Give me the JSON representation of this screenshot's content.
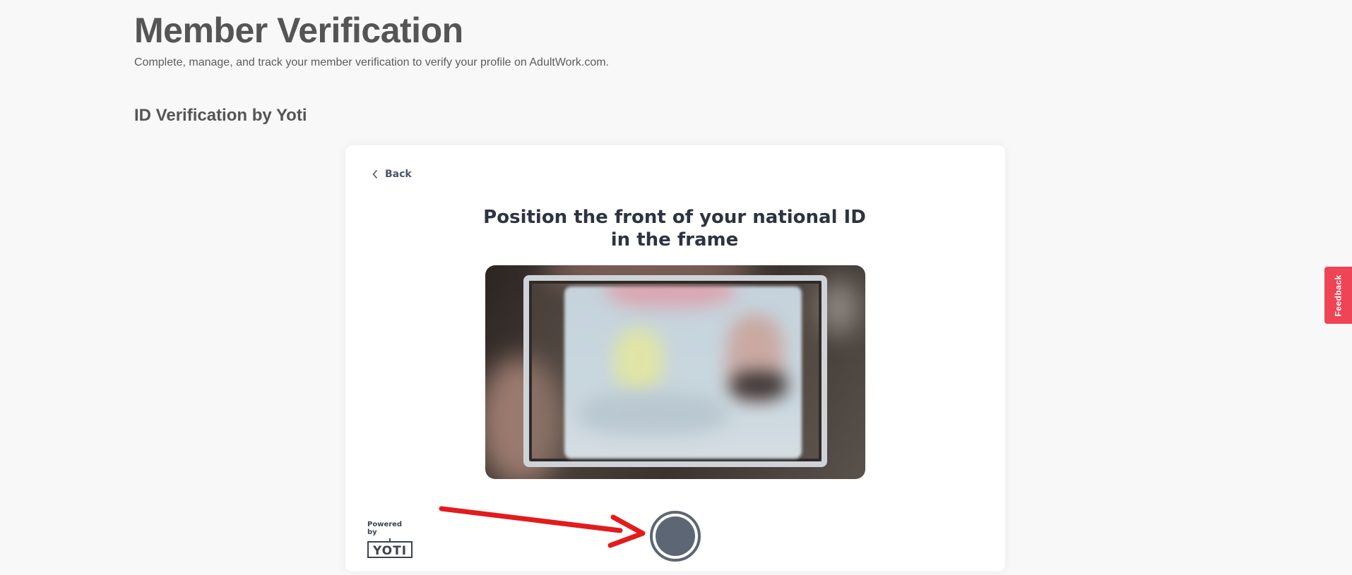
{
  "header": {
    "title": "Member Verification",
    "subtitle": "Complete, manage, and track your member verification to verify your profile on AdultWork.com."
  },
  "section": {
    "title": "ID Verification by Yoti"
  },
  "card": {
    "back_label": "Back",
    "instruction": "Position the front of your national ID in the frame",
    "powered_by_label": "Powered by",
    "brand_name": "YOTI"
  },
  "feedback": {
    "label": "Feedback"
  },
  "colors": {
    "accent_red": "#ee4455",
    "capture_button": "#5d6674",
    "annotation_arrow": "#e31b1b"
  },
  "icons": {
    "back": "chevron-left-icon",
    "capture": "shutter-icon",
    "annotation": "red-arrow-icon"
  }
}
